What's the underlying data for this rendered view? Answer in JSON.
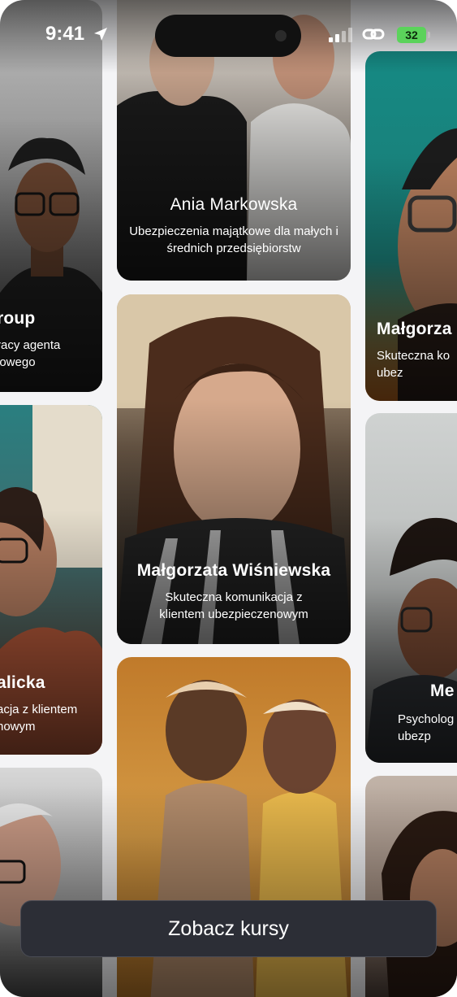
{
  "status_bar": {
    "time": "9:41",
    "battery": "32"
  },
  "cards": {
    "left_top": {
      "name": "roup",
      "desc": "racy agenta\niowego"
    },
    "left_mid": {
      "name": "alicka",
      "desc": "acja z klientem\nnowym"
    },
    "center_top": {
      "name": "Ania Markowska",
      "desc": "Ubezpieczenia majątkowe dla małych i średnich przedsiębiorstw"
    },
    "center_mid": {
      "name": "Małgorzata Wiśniewska",
      "desc": "Skuteczna komunikacja z klientem ubezpieczenowym"
    },
    "right_top": {
      "name": "Małgorza",
      "desc": "Skuteczna ko\nubez"
    },
    "right_mid": {
      "name": "Me",
      "desc": "Psycholog\nubezp"
    }
  },
  "cta": {
    "label": "Zobacz kursy"
  },
  "colors": {
    "cta_bg": "#2c2e36",
    "battery": "#5bd35b",
    "teal": "#1f8a86",
    "orange": "#c46a1e"
  }
}
